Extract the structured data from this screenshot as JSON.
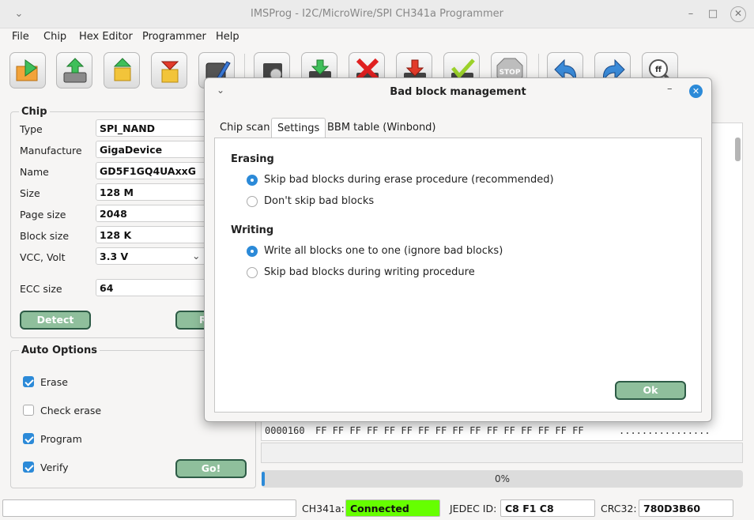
{
  "window": {
    "title": "IMSProg - I2C/MicroWire/SPI CH341a Programmer",
    "controls": {
      "minimize": "–",
      "maximize": "□",
      "close": "✕"
    }
  },
  "menu": [
    "File",
    "Chip",
    "Hex Editor",
    "Programmer",
    "Help"
  ],
  "toolbar": {
    "icons": [
      "open-folder-icon",
      "read-chip-icon",
      "load-part-icon",
      "save-part-icon",
      "edit-chip-icon",
      "chip-info-icon",
      "write-chip-icon",
      "erase-chip-icon",
      "verify-failed-icon",
      "verify-ok-icon",
      "stop-icon",
      "undo-icon",
      "redo-icon",
      "search-hex-icon"
    ],
    "stop_label": "STOP"
  },
  "chip": {
    "title": "Chip",
    "fields": [
      {
        "label": "Type",
        "value": "SPI_NAND"
      },
      {
        "label": "Manufacture",
        "value": "GigaDevice"
      },
      {
        "label": "Name",
        "value": "GD5F1GQ4UAxxG"
      },
      {
        "label": "Size",
        "value": "128 M"
      },
      {
        "label": "Page size",
        "value": "2048"
      },
      {
        "label": "Block size",
        "value": "128 K"
      },
      {
        "label": "VCC, Volt",
        "value": "3.3 V"
      }
    ],
    "ecc_label": "ECC size",
    "ecc_value": "64",
    "detect_label": "Detect",
    "second_button_label": "R"
  },
  "auto_options": {
    "title": "Auto Options",
    "items": [
      {
        "label": "Erase",
        "checked": true
      },
      {
        "label": "Check erase",
        "checked": false
      },
      {
        "label": "Program",
        "checked": true
      },
      {
        "label": "Verify",
        "checked": true
      }
    ],
    "go_label": "Go!"
  },
  "hex": {
    "address": "0000160",
    "bytes": "FF FF FF FF FF FF FF FF FF FF FF FF FF FF FF FF",
    "ascii": "................"
  },
  "progress": {
    "value_pct": 0,
    "label": "0%"
  },
  "status": {
    "ch341a_label": "CH341a:",
    "ch341a_value": "Connected",
    "jedec_label": "JEDEC ID:",
    "jedec_value": "C8 F1 C8",
    "crc_label": "CRC32:",
    "crc_value": "780D3B60"
  },
  "dialog": {
    "title": "Bad block management",
    "tabs": [
      "Chip scan",
      "Settings",
      "BBM table (Winbond)"
    ],
    "active_tab": 1,
    "erasing": {
      "title": "Erasing",
      "options": [
        "Skip bad blocks during erase procedure  (recommended)",
        "Don't skip bad blocks"
      ],
      "selected": 0
    },
    "writing": {
      "title": "Writing",
      "options": [
        "Write all blocks one to one (ignore bad blocks)",
        "Skip bad blocks during writing procedure"
      ],
      "selected": 0
    },
    "ok_label": "Ok"
  },
  "colors": {
    "accent": "#2c8ad8",
    "button_green": "#8fbf9c",
    "connected_green": "#66ff00"
  }
}
